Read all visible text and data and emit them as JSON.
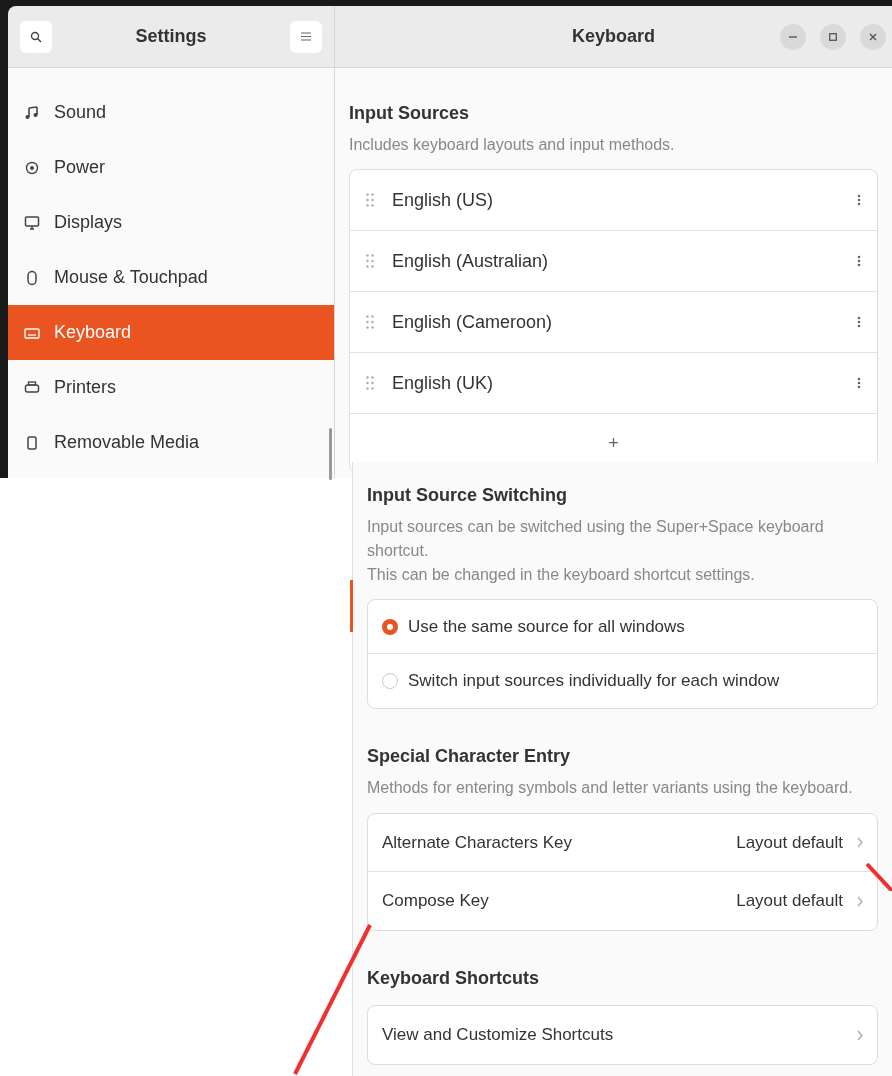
{
  "window": {
    "title": "Settings",
    "panel_title": "Keyboard"
  },
  "sidebar": {
    "items": [
      {
        "label": "Sound",
        "kind": "sound",
        "selected": false
      },
      {
        "label": "Power",
        "kind": "power",
        "selected": false
      },
      {
        "label": "Displays",
        "kind": "display",
        "selected": false
      },
      {
        "label": "Mouse & Touchpad",
        "kind": "mouse",
        "selected": false
      },
      {
        "label": "Keyboard",
        "kind": "keyboard",
        "selected": true
      },
      {
        "label": "Printers",
        "kind": "printer",
        "selected": false
      },
      {
        "label": "Removable Media",
        "kind": "media",
        "selected": false
      }
    ]
  },
  "input_sources": {
    "title": "Input Sources",
    "description": "Includes keyboard layouts and input methods.",
    "items": [
      {
        "label": "English (US)"
      },
      {
        "label": "English (Australian)"
      },
      {
        "label": "English (Cameroon)"
      },
      {
        "label": "English (UK)"
      }
    ],
    "add_button": "+"
  },
  "input_source_switching": {
    "title": "Input Source Switching",
    "description": [
      "Input sources can be switched using the Super+Space keyboard shortcut.",
      "This can be changed in the keyboard shortcut settings."
    ],
    "options": [
      {
        "label": "Use the same source for all windows",
        "selected": true
      },
      {
        "label": "Switch input sources individually for each window",
        "selected": false
      }
    ]
  },
  "special_character_entry": {
    "title": "Special Character Entry",
    "description": "Methods for entering symbols and letter variants using the keyboard.",
    "rows": [
      {
        "label": "Alternate Characters Key",
        "value": "Layout default"
      },
      {
        "label": "Compose Key",
        "value": "Layout default"
      }
    ]
  },
  "keyboard_shortcuts": {
    "title": "Keyboard Shortcuts",
    "rows": [
      {
        "label": "View and Customize Shortcuts"
      }
    ]
  }
}
